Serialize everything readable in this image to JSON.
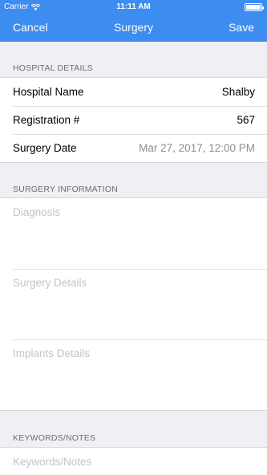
{
  "status_bar": {
    "carrier": "Carrier",
    "time": "11:11 AM",
    "battery_level": 1.0
  },
  "nav": {
    "cancel_label": "Cancel",
    "title": "Surgery",
    "save_label": "Save"
  },
  "hospital_details": {
    "header": "HOSPITAL DETAILS",
    "rows": [
      {
        "label": "Hospital Name",
        "value": "Shalby"
      },
      {
        "label": "Registration #",
        "value": "567"
      },
      {
        "label": "Surgery Date",
        "value": "Mar 27, 2017, 12:00 PM"
      }
    ]
  },
  "surgery_information": {
    "header": "SURGERY INFORMATION",
    "fields": [
      {
        "placeholder": "Diagnosis"
      },
      {
        "placeholder": "Surgery Details"
      },
      {
        "placeholder": "Implants Details"
      }
    ]
  },
  "keywords_notes": {
    "header": "KEYWORDS/NOTES",
    "placeholder": "Keywords/Notes"
  },
  "colors": {
    "accent": "#3d8cf0",
    "background": "#efeff4"
  }
}
